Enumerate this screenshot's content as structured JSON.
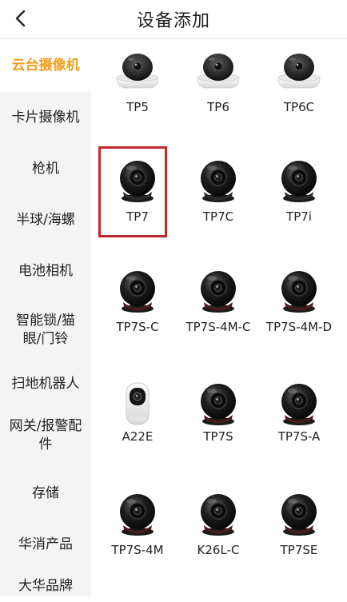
{
  "header": {
    "title": "设备添加",
    "back_icon": "chevron-left-icon"
  },
  "sidebar": {
    "active_color": "#f29d1c",
    "items": [
      {
        "label": "云台摄像机",
        "active": true
      },
      {
        "label": "卡片摄像机"
      },
      {
        "label": "枪机"
      },
      {
        "label": "半球/海螺"
      },
      {
        "label": "电池相机"
      },
      {
        "label": "智能锁/猫眼/门铃"
      },
      {
        "label": "扫地机器人"
      },
      {
        "label": "网关/报警配件"
      },
      {
        "label": "存储"
      },
      {
        "label": "华消产品"
      },
      {
        "label": "大华品牌"
      }
    ]
  },
  "devices": [
    {
      "name": "TP5",
      "style": "dome-white"
    },
    {
      "name": "TP6",
      "style": "dome-white"
    },
    {
      "name": "TP6C",
      "style": "dome-white"
    },
    {
      "name": "TP7",
      "style": "ball-black",
      "highlighted": true
    },
    {
      "name": "TP7C",
      "style": "ball-black"
    },
    {
      "name": "TP7i",
      "style": "ball-black"
    },
    {
      "name": "TP7S-C",
      "style": "ball-black-red"
    },
    {
      "name": "TP7S-4M-C",
      "style": "ball-black-red"
    },
    {
      "name": "TP7S-4M-D",
      "style": "ball-black-red"
    },
    {
      "name": "A22E",
      "style": "cube-white"
    },
    {
      "name": "TP7S",
      "style": "ball-black-red"
    },
    {
      "name": "TP7S-A",
      "style": "ball-black-red"
    },
    {
      "name": "TP7S-4M",
      "style": "ball-black-red"
    },
    {
      "name": "K26L-C",
      "style": "ball-black-red"
    },
    {
      "name": "TP7SE",
      "style": "ball-black-red"
    }
  ],
  "highlight_color": "#c0282a"
}
